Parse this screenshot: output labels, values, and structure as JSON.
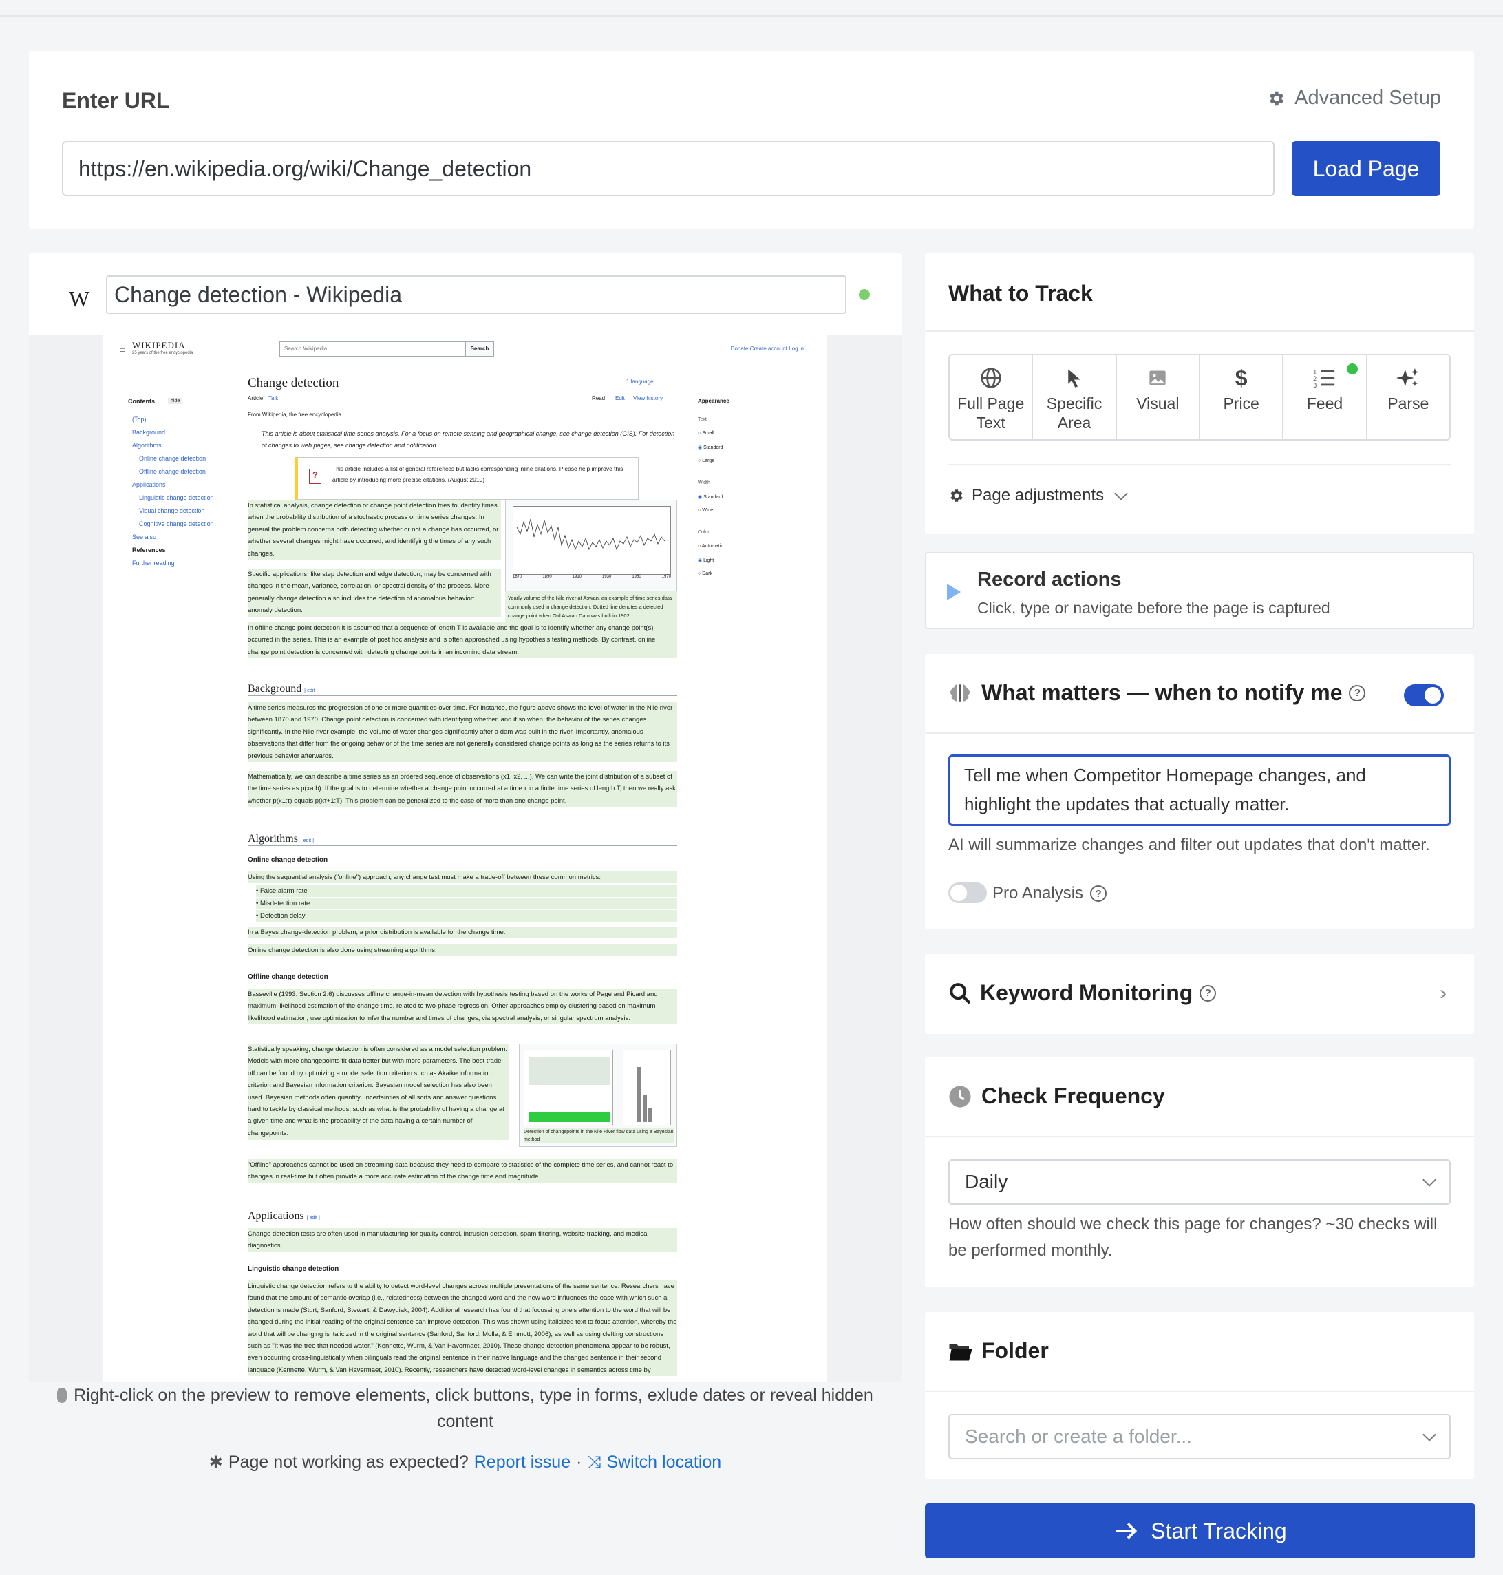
{
  "url_section": {
    "label": "Enter URL",
    "advanced": "Advanced Setup",
    "url_value": "https://en.wikipedia.org/wiki/Change_detection",
    "load_button": "Load Page"
  },
  "preview": {
    "logo_letter": "W",
    "page_title": "Change detection - Wikipedia",
    "hint": "Right-click on the preview to remove elements, click buttons, type in forms, exlude dates or reveal hidden content",
    "not_working": "Page not working as expected?",
    "report_issue": "Report issue",
    "separator": "·",
    "switch_location": "Switch location"
  },
  "wiki": {
    "brand": "WIKIPEDIA",
    "tagline": "25 years of the free encyclopedia",
    "search_placeholder": "Search Wikipedia",
    "search_button": "Search",
    "top_links": "Donate  Create account  Log in",
    "title": "Change detection",
    "languages": "1 language",
    "tab_article": "Article",
    "tab_talk": "Talk",
    "tab_read": "Read",
    "tab_edit": "Edit",
    "tab_history": "View history",
    "from": "From Wikipedia, the free encyclopedia",
    "hatnote": "This article is about statistical time series analysis. For a focus on remote sensing and geographical change, see change detection (GIS). For detection of changes to web pages, see change detection and notification.",
    "notice": "This article includes a list of general references but lacks corresponding inline citations. Please help improve this article by introducing more precise citations. (August 2010)",
    "contents_label": "Contents",
    "hide": "hide",
    "toc": [
      "(Top)",
      "Background",
      "Algorithms",
      "Online change detection",
      "Offline change detection",
      "Applications",
      "Linguistic change detection",
      "Visual change detection",
      "Cognitive change detection",
      "See also",
      "References",
      "Further reading"
    ],
    "appearance": "Appearance",
    "text_label": "Text",
    "text_opts": [
      "Small",
      "Standard",
      "Large"
    ],
    "width_label": "Width",
    "width_opts": [
      "Standard",
      "Wide"
    ],
    "color_label": "Color",
    "color_opts": [
      "Automatic",
      "Light",
      "Dark"
    ],
    "intro_p1": "In statistical analysis, change detection or change point detection tries to identify times when the probability distribution of a stochastic process or time series changes. In general the problem concerns both detecting whether or not a change has occurred, or whether several changes might have occurred, and identifying the times of any such changes.",
    "intro_p2": "Specific applications, like step detection and edge detection, may be concerned with changes in the mean, variance, correlation, or spectral density of the process. More generally change detection also includes the detection of anomalous behavior: anomaly detection.",
    "intro_p3": "In offline change point detection it is assumed that a sequence of length T is available and the goal is to identify whether any change point(s) occurred in the series. This is an example of post hoc analysis and is often approached using hypothesis testing methods. By contrast, online change point detection is concerned with detecting change points in an incoming data stream.",
    "figure_caption": "Yearly volume of the Nile river at Aswan, an example of time series data commonly used in change detection. Dotted line denotes a detected change point when Old Aswan Dam was built in 1902.",
    "fig_years": [
      "1870",
      "1890",
      "1910",
      "1930",
      "1950",
      "1970"
    ],
    "h_background": "Background",
    "edit": "edit",
    "bg_p1": "A time series measures the progression of one or more quantities over time. For instance, the figure above shows the level of water in the Nile river between 1870 and 1970. Change point detection is concerned with identifying whether, and if so when, the behavior of the series changes significantly. In the Nile river example, the volume of water changes significantly after a dam was built in the river. Importantly, anomalous observations that differ from the ongoing behavior of the time series are not generally considered change points as long as the series returns to its previous behavior afterwards.",
    "bg_p2": "Mathematically, we can describe a time series as an ordered sequence of observations (x1, x2, ...). We can write the joint distribution of a subset of the time series as p(xa:b). If the goal is to determine whether a change point occurred at a time τ in a finite time series of length T, then we really ask whether p(x1:τ) equals p(xτ+1:T). This problem can be generalized to the case of more than one change point.",
    "h_algorithms": "Algorithms",
    "h_online": "Online change detection",
    "online_p1": "Using the sequential analysis (\"online\") approach, any change test must make a trade-off between these common metrics:",
    "online_list": [
      "False alarm rate",
      "Misdetection rate",
      "Detection delay"
    ],
    "online_p2": "In a Bayes change-detection problem, a prior distribution is available for the change time.",
    "online_p3": "Online change detection is also done using streaming algorithms.",
    "h_offline": "Offline change detection",
    "offline_p1": "Basseville (1993, Section 2.6) discusses offline change-in-mean detection with hypothesis testing based on the works of Page and Picard and maximum-likelihood estimation of the change time, related to two-phase regression. Other approaches employ clustering based on maximum likelihood estimation, use optimization to infer the number and times of changes, via spectral analysis, or singular spectrum analysis.",
    "offline_p2": "Statistically speaking, change detection is often considered as a model selection problem. Models with more changepoints fit data better but with more parameters. The best trade-off can be found by optimizing a model selection criterion such as Akaike information criterion and Bayesian information criterion. Bayesian model selection has also been used. Bayesian methods often quantify uncertainties of all sorts and answer questions hard to tackle by classical methods, such as what is the probability of having a change at a given time and what is the probability of the data having a certain number of changepoints.",
    "offline_p3": "\"Offline\" approaches cannot be used on streaming data because they need to compare to statistics of the complete time series, and cannot react to changes in real-time but often provide a more accurate estimation of the change time and magnitude.",
    "fig2_caption": "Detection of changepoints in the Nile River flow data using a Bayesian method",
    "h_applications": "Applications",
    "app_p1": "Change detection tests are often used in manufacturing for quality control, intrusion detection, spam filtering, website tracking, and medical diagnostics.",
    "h_linguistic": "Linguistic change detection",
    "ling_p1": "Linguistic change detection refers to the ability to detect word-level changes across multiple presentations of the same sentence. Researchers have found that the amount of semantic overlap (i.e., relatedness) between the changed word and the new word influences the ease with which such a detection is made (Sturt, Sanford, Stewart, & Dawydiak, 2004). Additional research has found that focussing one's attention to the word that will be changed during the initial reading of the original sentence can improve detection. This was shown using italicized text to focus attention, whereby the word that will be changing is italicized in the original sentence (Sanford, Sanford, Molle, & Emmott, 2006), as well as using clefting constructions such as \"It was the tree that needed water.\" (Kennette, Wurm, & Van Havermaet, 2010). These change-detection phenomena appear to be robust, even occurring cross-linguistically when bilinguals read the original sentence in their native language and the changed sentence in their second language (Kennette, Wurm, & Van Havermaet, 2010). Recently, researchers have detected word-level changes in semantics across time by"
  },
  "track": {
    "title": "What to Track",
    "tabs": [
      {
        "label": "Full Page Text",
        "icon": "globe-icon"
      },
      {
        "label": "Specific Area",
        "icon": "cursor-icon"
      },
      {
        "label": "Visual",
        "icon": "image-icon"
      },
      {
        "label": "Price",
        "icon": "dollar-icon"
      },
      {
        "label": "Feed",
        "icon": "list-icon"
      },
      {
        "label": "Parse",
        "icon": "sparkle-icon"
      }
    ],
    "page_adjustments": "Page adjustments"
  },
  "record": {
    "title": "Record actions",
    "subtitle": "Click, type or navigate before the page is captured"
  },
  "notify": {
    "title": "What matters — when to notify me",
    "enabled": true,
    "prompt": "Tell me when Competitor Homepage changes, and highlight the updates that actually matter.",
    "ai_note": "AI will summarize changes and filter out updates that don't matter.",
    "pro_label": "Pro Analysis",
    "pro_enabled": false
  },
  "keyword": {
    "title": "Keyword Monitoring"
  },
  "frequency": {
    "title": "Check Frequency",
    "value": "Daily",
    "note": "How often should we check this page for changes? ~30 checks will be performed monthly."
  },
  "folder": {
    "title": "Folder",
    "placeholder": "Search or create a folder..."
  },
  "start_button": "Start Tracking",
  "colors": {
    "primary": "#2452c6",
    "status_green": "#7ccf6c",
    "feed_dot": "#39c04a",
    "wiki_highlight": "#e4f1de"
  }
}
